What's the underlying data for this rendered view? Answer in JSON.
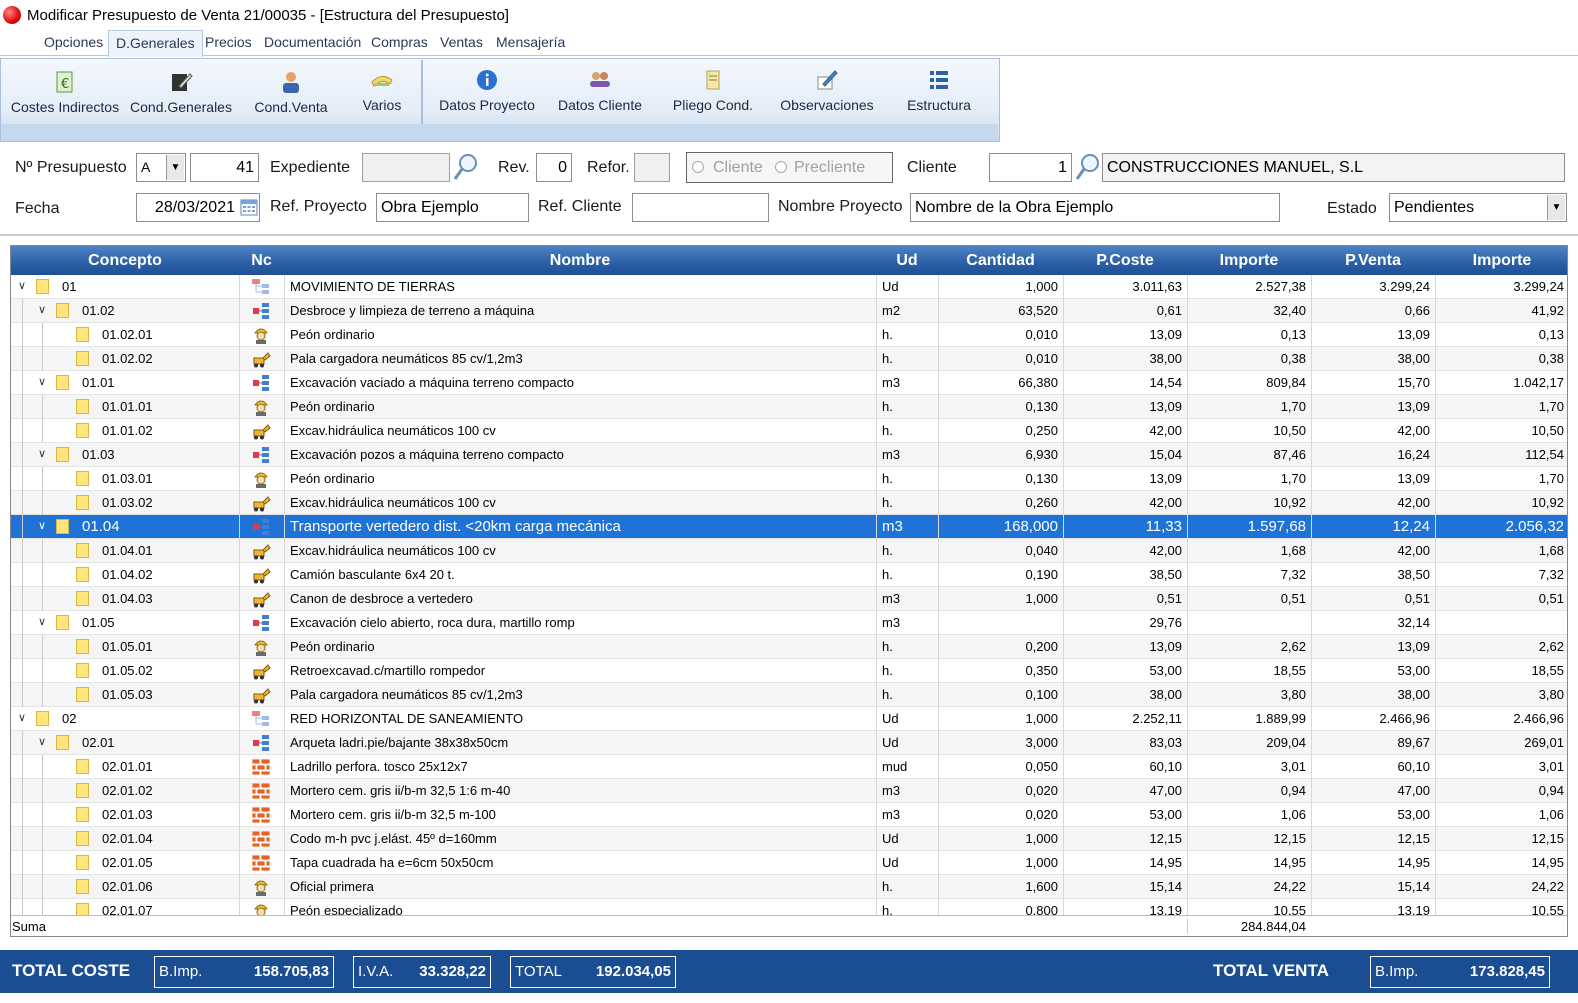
{
  "window": {
    "title": "Modificar Presupuesto de Venta 21/00035 - [Estructura del Presupuesto]"
  },
  "menu": [
    "Opciones",
    "D.Generales",
    "Precios",
    "Documentación",
    "Compras",
    "Ventas",
    "Mensajería"
  ],
  "ribbon": {
    "group1": [
      "Costes Indirectos",
      "Cond.Generales",
      "Cond.Venta",
      "Varios"
    ],
    "group2": [
      "Datos Proyecto",
      "Datos Cliente",
      "Pliego Cond.",
      "Observaciones",
      "Estructura"
    ]
  },
  "form": {
    "presupuesto_label": "Nº Presupuesto",
    "serie": "A",
    "numero": "41",
    "expediente_label": "Expediente",
    "expediente": "",
    "rev_label": "Rev.",
    "rev": "0",
    "refor_label": "Refor.",
    "refor": "",
    "radio_cliente": "Cliente",
    "radio_precliente": "Precliente",
    "cliente_label": "Cliente",
    "cliente_num": "1",
    "cliente_nombre": "CONSTRUCCIONES MANUEL, S.L",
    "fecha_label": "Fecha",
    "fecha": "28/03/2021",
    "ref_proyecto_label": "Ref. Proyecto",
    "ref_proyecto": "Obra Ejemplo",
    "ref_cliente_label": "Ref. Cliente",
    "ref_cliente": "",
    "nombre_proyecto_label": "Nombre Proyecto",
    "nombre_proyecto": "Nombre de la Obra Ejemplo",
    "estado_label": "Estado",
    "estado": "Pendientes"
  },
  "grid": {
    "headers": [
      "Concepto",
      "Nc",
      "Nombre",
      "Ud",
      "Cantidad",
      "P.Coste",
      "Importe",
      "P.Venta",
      "Importe"
    ],
    "rows": [
      {
        "code": "01",
        "level": 0,
        "exp": true,
        "nc": "chapter",
        "name": "MOVIMIENTO DE TIERRAS",
        "ud": "Ud",
        "qty": "1,000",
        "pc": "3.011,63",
        "imp": "2.527,38",
        "pv": "3.299,24",
        "imp2": "3.299,24"
      },
      {
        "code": "01.02",
        "level": 1,
        "exp": true,
        "nc": "item",
        "name": "Desbroce y limpieza de terreno a máquina",
        "ud": "m2",
        "qty": "63,520",
        "pc": "0,61",
        "imp": "32,40",
        "pv": "0,66",
        "imp2": "41,92"
      },
      {
        "code": "01.02.01",
        "level": 2,
        "exp": false,
        "nc": "labor",
        "name": "Peón ordinario",
        "ud": "h.",
        "qty": "0,010",
        "pc": "13,09",
        "imp": "0,13",
        "pv": "13,09",
        "imp2": "0,13"
      },
      {
        "code": "01.02.02",
        "level": 2,
        "exp": false,
        "nc": "machine",
        "name": "Pala cargadora neumáticos 85 cv/1,2m3",
        "ud": "h.",
        "qty": "0,010",
        "pc": "38,00",
        "imp": "0,38",
        "pv": "38,00",
        "imp2": "0,38"
      },
      {
        "code": "01.01",
        "level": 1,
        "exp": true,
        "nc": "item",
        "name": "Excavación vaciado a máquina terreno compacto",
        "ud": "m3",
        "qty": "66,380",
        "pc": "14,54",
        "imp": "809,84",
        "pv": "15,70",
        "imp2": "1.042,17"
      },
      {
        "code": "01.01.01",
        "level": 2,
        "exp": false,
        "nc": "labor",
        "name": "Peón ordinario",
        "ud": "h.",
        "qty": "0,130",
        "pc": "13,09",
        "imp": "1,70",
        "pv": "13,09",
        "imp2": "1,70"
      },
      {
        "code": "01.01.02",
        "level": 2,
        "exp": false,
        "nc": "machine",
        "name": "Excav.hidráulica neumáticos 100 cv",
        "ud": "h.",
        "qty": "0,250",
        "pc": "42,00",
        "imp": "10,50",
        "pv": "42,00",
        "imp2": "10,50"
      },
      {
        "code": "01.03",
        "level": 1,
        "exp": true,
        "nc": "item",
        "name": "Excavación pozos a máquina terreno compacto",
        "ud": "m3",
        "qty": "6,930",
        "pc": "15,04",
        "imp": "87,46",
        "pv": "16,24",
        "imp2": "112,54"
      },
      {
        "code": "01.03.01",
        "level": 2,
        "exp": false,
        "nc": "labor",
        "name": "Peón ordinario",
        "ud": "h.",
        "qty": "0,130",
        "pc": "13,09",
        "imp": "1,70",
        "pv": "13,09",
        "imp2": "1,70"
      },
      {
        "code": "01.03.02",
        "level": 2,
        "exp": false,
        "nc": "machine",
        "name": "Excav.hidráulica neumáticos 100 cv",
        "ud": "h.",
        "qty": "0,260",
        "pc": "42,00",
        "imp": "10,92",
        "pv": "42,00",
        "imp2": "10,92"
      },
      {
        "code": "01.04",
        "level": 1,
        "exp": true,
        "sel": true,
        "nc": "item",
        "name": "Transporte vertedero dist. <20km carga mecánica",
        "ud": "m3",
        "qty": "168,000",
        "pc": "11,33",
        "imp": "1.597,68",
        "pv": "12,24",
        "imp2": "2.056,32"
      },
      {
        "code": "01.04.01",
        "level": 2,
        "exp": false,
        "nc": "machine",
        "name": "Excav.hidráulica neumáticos 100 cv",
        "ud": "h.",
        "qty": "0,040",
        "pc": "42,00",
        "imp": "1,68",
        "pv": "42,00",
        "imp2": "1,68"
      },
      {
        "code": "01.04.02",
        "level": 2,
        "exp": false,
        "nc": "machine",
        "name": "Camión basculante 6x4 20 t.",
        "ud": "h.",
        "qty": "0,190",
        "pc": "38,50",
        "imp": "7,32",
        "pv": "38,50",
        "imp2": "7,32"
      },
      {
        "code": "01.04.03",
        "level": 2,
        "exp": false,
        "nc": "machine",
        "name": "Canon de desbroce a vertedero",
        "ud": "m3",
        "qty": "1,000",
        "pc": "0,51",
        "imp": "0,51",
        "pv": "0,51",
        "imp2": "0,51"
      },
      {
        "code": "01.05",
        "level": 1,
        "exp": true,
        "nc": "item",
        "name": "Excavación cielo abierto, roca dura, martillo romp",
        "ud": "m3",
        "qty": "",
        "pc": "29,76",
        "imp": "",
        "pv": "32,14",
        "imp2": ""
      },
      {
        "code": "01.05.01",
        "level": 2,
        "exp": false,
        "nc": "labor",
        "name": "Peón ordinario",
        "ud": "h.",
        "qty": "0,200",
        "pc": "13,09",
        "imp": "2,62",
        "pv": "13,09",
        "imp2": "2,62"
      },
      {
        "code": "01.05.02",
        "level": 2,
        "exp": false,
        "nc": "machine",
        "name": "Retroexcavad.c/martillo rompedor",
        "ud": "h.",
        "qty": "0,350",
        "pc": "53,00",
        "imp": "18,55",
        "pv": "53,00",
        "imp2": "18,55"
      },
      {
        "code": "01.05.03",
        "level": 2,
        "exp": false,
        "nc": "machine",
        "name": "Pala cargadora neumáticos 85 cv/1,2m3",
        "ud": "h.",
        "qty": "0,100",
        "pc": "38,00",
        "imp": "3,80",
        "pv": "38,00",
        "imp2": "3,80"
      },
      {
        "code": "02",
        "level": 0,
        "exp": true,
        "nc": "chapter",
        "name": "RED HORIZONTAL DE SANEAMIENTO",
        "ud": "Ud",
        "qty": "1,000",
        "pc": "2.252,11",
        "imp": "1.889,99",
        "pv": "2.466,96",
        "imp2": "2.466,96"
      },
      {
        "code": "02.01",
        "level": 1,
        "exp": true,
        "nc": "item",
        "name": "Arqueta ladri.pie/bajante 38x38x50cm",
        "ud": "Ud",
        "qty": "3,000",
        "pc": "83,03",
        "imp": "209,04",
        "pv": "89,67",
        "imp2": "269,01"
      },
      {
        "code": "02.01.01",
        "level": 2,
        "exp": false,
        "nc": "material",
        "name": "Ladrillo perfora. tosco 25x12x7",
        "ud": "mud",
        "qty": "0,050",
        "pc": "60,10",
        "imp": "3,01",
        "pv": "60,10",
        "imp2": "3,01"
      },
      {
        "code": "02.01.02",
        "level": 2,
        "exp": false,
        "nc": "material",
        "name": "Mortero cem. gris ii/b-m 32,5 1:6 m-40",
        "ud": "m3",
        "qty": "0,020",
        "pc": "47,00",
        "imp": "0,94",
        "pv": "47,00",
        "imp2": "0,94"
      },
      {
        "code": "02.01.03",
        "level": 2,
        "exp": false,
        "nc": "material",
        "name": "Mortero cem. gris ii/b-m 32,5 m-100",
        "ud": "m3",
        "qty": "0,020",
        "pc": "53,00",
        "imp": "1,06",
        "pv": "53,00",
        "imp2": "1,06"
      },
      {
        "code": "02.01.04",
        "level": 2,
        "exp": false,
        "nc": "material",
        "name": "Codo m-h pvc j.elást. 45º d=160mm",
        "ud": "Ud",
        "qty": "1,000",
        "pc": "12,15",
        "imp": "12,15",
        "pv": "12,15",
        "imp2": "12,15"
      },
      {
        "code": "02.01.05",
        "level": 2,
        "exp": false,
        "nc": "material",
        "name": "Tapa cuadrada ha e=6cm 50x50cm",
        "ud": "Ud",
        "qty": "1,000",
        "pc": "14,95",
        "imp": "14,95",
        "pv": "14,95",
        "imp2": "14,95"
      },
      {
        "code": "02.01.06",
        "level": 2,
        "exp": false,
        "nc": "labor",
        "name": "Oficial primera",
        "ud": "h.",
        "qty": "1,600",
        "pc": "15,14",
        "imp": "24,22",
        "pv": "15,14",
        "imp2": "24,22"
      },
      {
        "code": "02.01.07",
        "level": 2,
        "exp": false,
        "nc": "labor",
        "name": "Peón especializado",
        "ud": "h.",
        "qty": "0,800",
        "pc": "13,19",
        "imp": "10,55",
        "pv": "13,19",
        "imp2": "10,55"
      }
    ],
    "suma_label": "Suma",
    "suma_importe": "284.844,04"
  },
  "totals": {
    "coste_title": "TOTAL COSTE",
    "bimp_label": "B.Imp.",
    "bimp_coste": "158.705,83",
    "iva_label": "I.V.A.",
    "iva": "33.328,22",
    "total_label": "TOTAL",
    "total": "192.034,05",
    "venta_title": "TOTAL VENTA",
    "bimp_venta": "173.828,45"
  },
  "colors": {
    "header_blue": "#2d62a8",
    "selected_row": "#1f72d6",
    "totals_bar": "#1b4d92"
  }
}
